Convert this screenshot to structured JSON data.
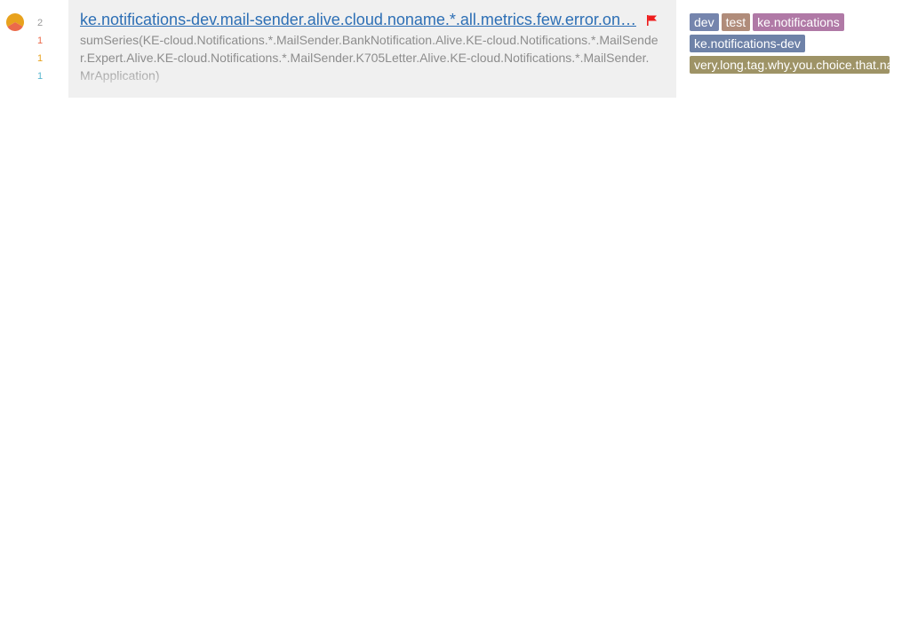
{
  "status": {
    "pie_colors": [
      "#e8a21d",
      "#eb6a4a",
      "#58b6cf"
    ],
    "counts": [
      {
        "value": "2",
        "color": "#9a9a9a"
      },
      {
        "value": "1",
        "color": "#eb6a4a"
      },
      {
        "value": "1",
        "color": "#e8a21d"
      },
      {
        "value": "1",
        "color": "#58b6cf"
      }
    ]
  },
  "trigger": {
    "name": "ke.notifications-dev.mail-sender.alive.cloud.noname.*.all.metrics.few.error.on…",
    "flag_color": "#ee1c1c",
    "target_line1": "sumSeries(KE-cloud.Notifications.*.MailSender.BankNotification.Alive.KE-cloud.Notifications.*.MailSende",
    "target_line2": "r.Expert.Alive.KE-cloud.Notifications.*.MailSender.K705Letter.Alive.KE-cloud.Notifications.*.MailSender.",
    "target_line3": "MrApplication)"
  },
  "tags": [
    {
      "label": "dev",
      "color": "#7585ad"
    },
    {
      "label": "test",
      "color": "#b08c7a"
    },
    {
      "label": "ke.notifications",
      "color": "#b079a6"
    },
    {
      "label": "ke.notifications-dev",
      "color": "#6e82a8"
    },
    {
      "label": "very.long.tag.why.you.choice.that.name",
      "color": "#9e9366"
    }
  ]
}
